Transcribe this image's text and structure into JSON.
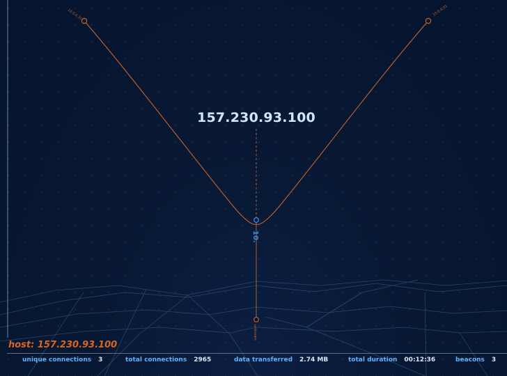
{
  "graph": {
    "center_host": "157.230.93.100",
    "source_node_label": "10.",
    "bottom_node_label": "unknown",
    "left_peer_label": "10.0.0.31",
    "right_peer_label": "10.0.0.31"
  },
  "host_summary": {
    "label": "host: 157.230.93.100"
  },
  "stats": [
    {
      "label": "unique connections",
      "value": "3"
    },
    {
      "label": "total connections",
      "value": "2965"
    },
    {
      "label": "data transferred",
      "value": "2.74 MB"
    },
    {
      "label": "total duration",
      "value": "00:12:36"
    },
    {
      "label": "beacons",
      "value": "3"
    }
  ],
  "colors": {
    "background": "#06142e",
    "edge_orange": "#c9622a",
    "node_blue": "#3a8bd8",
    "text_orange": "#d9651f",
    "stat_label": "#5fb2ff"
  }
}
